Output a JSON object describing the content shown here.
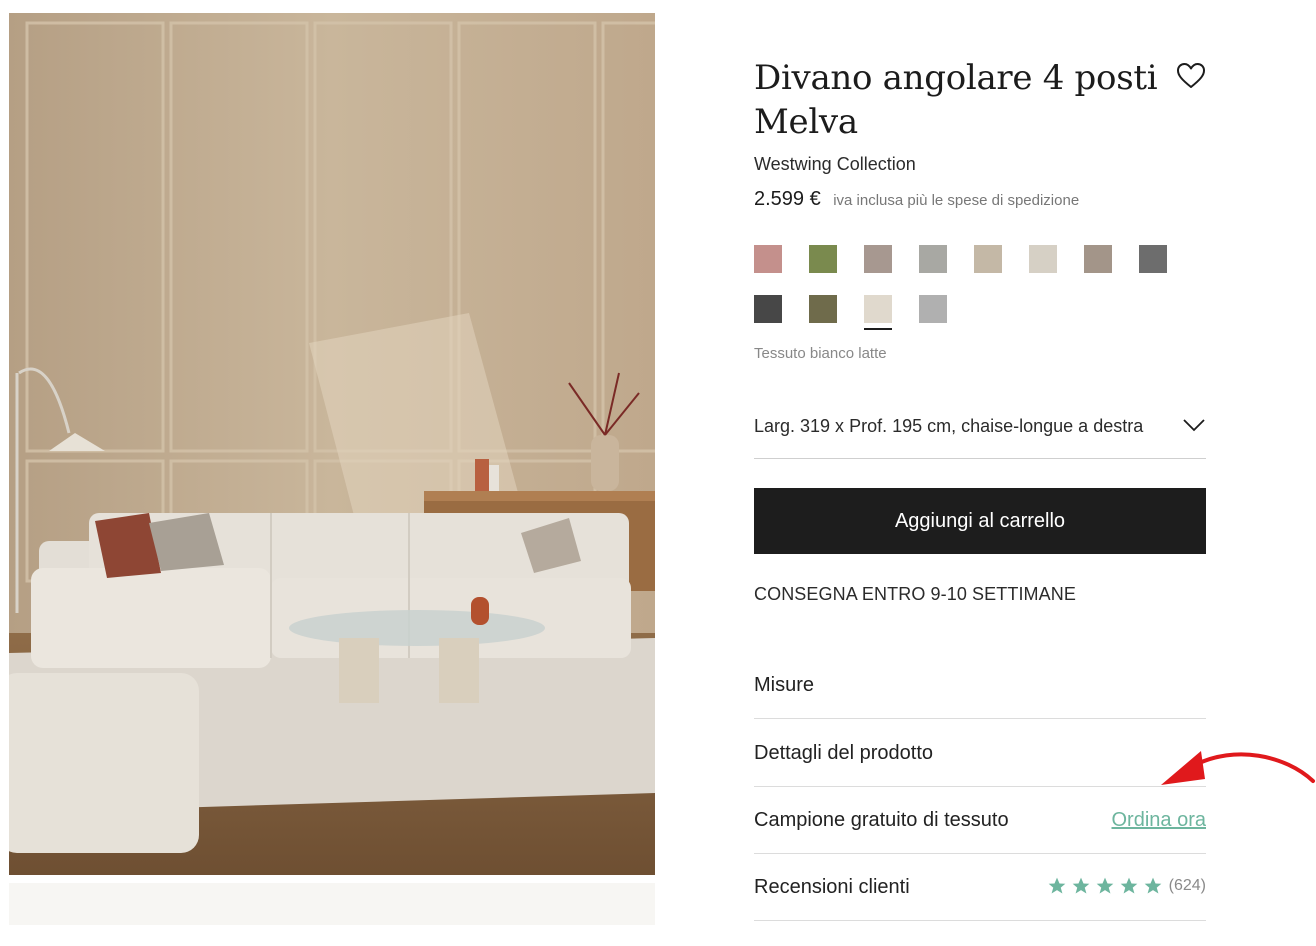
{
  "product": {
    "title": "Divano angolare 4 posti Melva",
    "brand": "Westwing Collection",
    "price": "2.599 €",
    "vat_note": "iva inclusa più le spese di spedizione"
  },
  "swatches": [
    {
      "color": "#c4908c",
      "selected": false
    },
    {
      "color": "#7a8a4e",
      "selected": false
    },
    {
      "color": "#a79890",
      "selected": false
    },
    {
      "color": "#a8a8a3",
      "selected": false
    },
    {
      "color": "#c4b8a6",
      "selected": false
    },
    {
      "color": "#d6d0c5",
      "selected": false
    },
    {
      "color": "#a39589",
      "selected": false
    },
    {
      "color": "#6d6d6d",
      "selected": false
    },
    {
      "color": "#474747",
      "selected": false
    },
    {
      "color": "#6f6b4b",
      "selected": false
    },
    {
      "color": "#e0d9cd",
      "selected": true
    },
    {
      "color": "#b0b0b0",
      "selected": false
    }
  ],
  "selected_fabric": "Tessuto bianco latte",
  "size_select": {
    "value": "Larg. 319 x Prof. 195 cm, chaise-longue a destra",
    "icon": "chevron-down-icon"
  },
  "cart_button": "Aggiungi al carrello",
  "delivery": "CONSEGNA ENTRO 9-10 SETTIMANE",
  "accordion": {
    "measures": "Misure",
    "details": "Dettagli del prodotto",
    "sample": "Campione gratuito di tessuto",
    "sample_link": "Ordina ora",
    "reviews": "Recensioni clienti",
    "review_count": "(624)",
    "rating_stars": 5
  },
  "colors": {
    "accent_link": "#6db59e",
    "button_bg": "#1d1d1d",
    "annotation_arrow": "#e0191c"
  },
  "icons": {
    "wishlist": "heart-icon",
    "star": "star-icon",
    "annotation": "red-arrow-annotation"
  }
}
